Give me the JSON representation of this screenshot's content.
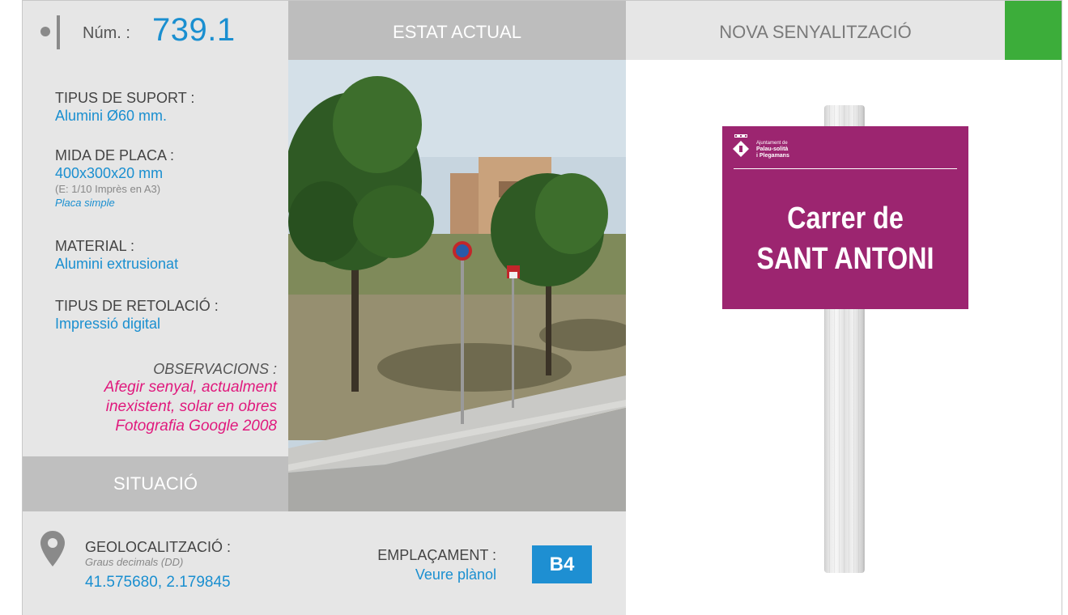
{
  "header": {
    "num_label": "Núm. :",
    "num_value": "739.1",
    "estat_actual": "ESTAT ACTUAL",
    "nova_senyalitzacio": "NOVA SENYALITZACIÓ",
    "accent_green": "#3cad3a"
  },
  "fields": {
    "suport_label": "TIPUS DE SUPORT :",
    "suport_value": "Alumini Ø60 mm.",
    "mida_label": "MIDA DE PLACA :",
    "mida_value": "400x300x20 mm",
    "mida_scale": "(E: 1/10 Imprès en A3)",
    "mida_type": "Placa simple",
    "material_label": "MATERIAL :",
    "material_value": "Alumini extrusionat",
    "retolacio_label": "TIPUS DE RETOLACIÓ :",
    "retolacio_value": "Impressió digital"
  },
  "observacions": {
    "label": "OBSERVACIONS :",
    "line1": "Afegir senyal, actualment",
    "line2": "inexistent, solar en obres",
    "line3": "Fotografia Google 2008"
  },
  "situacio": {
    "label": "SITUACIÓ"
  },
  "geolocalitzacio": {
    "label": "GEOLOCALITZACIÓ :",
    "sub": "Graus decimals (DD)",
    "value": "41.575680, 2.179845",
    "icon": "map-pin-icon"
  },
  "emplacament": {
    "label": "EMPLAÇAMENT :",
    "value": "Veure plànol",
    "badge": "B4",
    "badge_color": "#1e8fd2"
  },
  "sign": {
    "logo_line1": "Ajuntament de",
    "logo_line2": "Palau-solità",
    "logo_line3": "i Plegamans",
    "line1": "Carrer de",
    "line2": "SANT ANTONI",
    "color": "#9c2570"
  }
}
